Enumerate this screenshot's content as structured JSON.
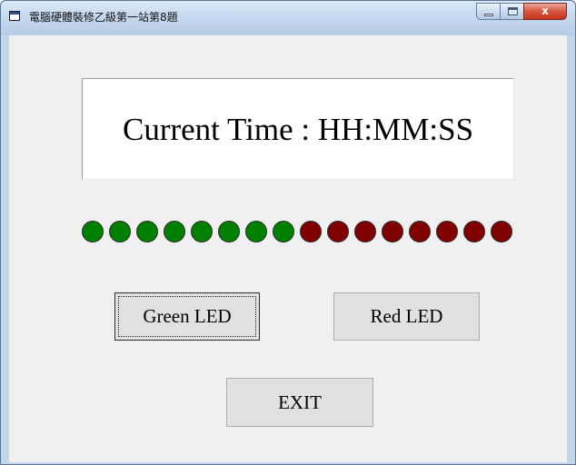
{
  "window": {
    "title": "電腦硬體裝修乙級第一站第8題",
    "app_icon": "form-icon",
    "controls": {
      "minimize": "minimize-icon",
      "maximize": "maximize-icon",
      "close": "close-icon",
      "close_glyph": "x"
    }
  },
  "display": {
    "time_text": "Current Time : HH:MM:SS"
  },
  "leds": {
    "states": [
      "green",
      "green",
      "green",
      "green",
      "green",
      "green",
      "green",
      "green",
      "red",
      "red",
      "red",
      "red",
      "red",
      "red",
      "red",
      "red"
    ],
    "colors": {
      "green": "#008000",
      "red": "#800000"
    }
  },
  "buttons": {
    "green_led": "Green LED",
    "red_led": "Red LED",
    "exit": "EXIT"
  }
}
